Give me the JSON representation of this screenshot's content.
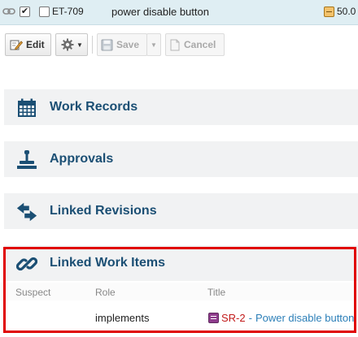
{
  "work_item": {
    "id": "ET-709",
    "title": "power disable button",
    "value": "50.0"
  },
  "toolbar": {
    "edit_label": "Edit",
    "save_label": "Save",
    "cancel_label": "Cancel"
  },
  "sections": {
    "work_records": "Work Records",
    "approvals": "Approvals",
    "linked_revisions": "Linked Revisions",
    "linked_work_items": "Linked Work Items"
  },
  "linked_table": {
    "columns": [
      "Suspect",
      "Role",
      "Title"
    ],
    "rows": [
      {
        "suspect": "",
        "role": "implements",
        "item_id": "SR-2",
        "separator": "-",
        "item_title": "Power disable button"
      }
    ]
  },
  "colors": {
    "section_title": "#1b4f74",
    "link": "#2c7fb8",
    "item_id": "#c21a1a",
    "highlight": "#e00000"
  }
}
